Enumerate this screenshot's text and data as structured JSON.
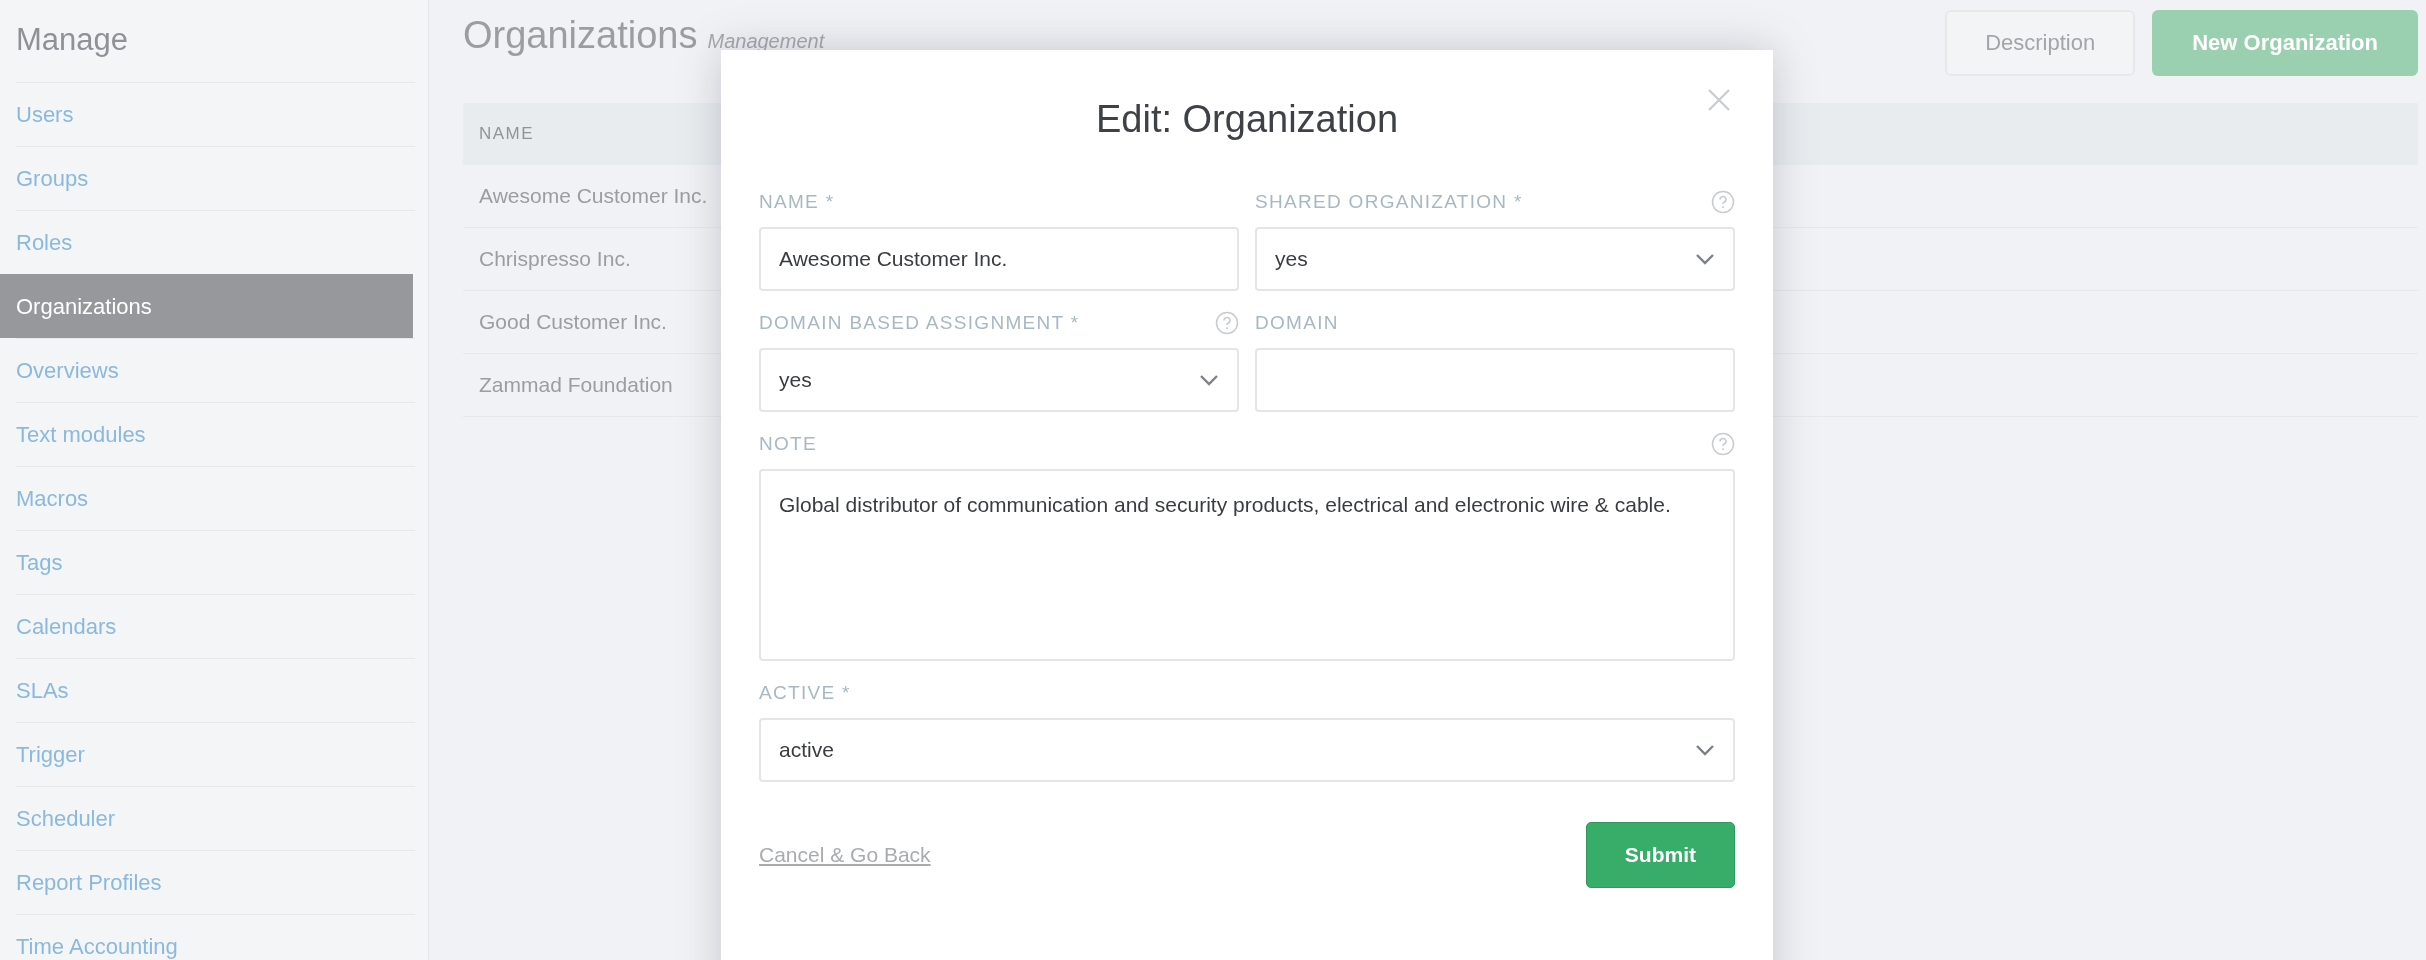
{
  "sidebar": {
    "title": "Manage",
    "items": [
      {
        "label": "Users",
        "selected": false
      },
      {
        "label": "Groups",
        "selected": false
      },
      {
        "label": "Roles",
        "selected": false
      },
      {
        "label": "Organizations",
        "selected": true
      },
      {
        "label": "Overviews",
        "selected": false
      },
      {
        "label": "Text modules",
        "selected": false
      },
      {
        "label": "Macros",
        "selected": false
      },
      {
        "label": "Tags",
        "selected": false
      },
      {
        "label": "Calendars",
        "selected": false
      },
      {
        "label": "SLAs",
        "selected": false
      },
      {
        "label": "Trigger",
        "selected": false
      },
      {
        "label": "Scheduler",
        "selected": false
      },
      {
        "label": "Report Profiles",
        "selected": false
      },
      {
        "label": "Time Accounting",
        "selected": false
      }
    ]
  },
  "page": {
    "title": "Organizations",
    "subtitle": "Management",
    "buttons": [
      {
        "label": "Description",
        "kind": "secondary"
      },
      {
        "label": "New Organization",
        "kind": "primary"
      }
    ]
  },
  "table": {
    "columns": [
      "NAME"
    ],
    "rows": [
      "Awesome Customer Inc.",
      "Chrispresso Inc.",
      "Good Customer Inc.",
      "Zammad Foundation"
    ]
  },
  "dialog": {
    "title": "Edit: Organization",
    "rows": [
      [
        {
          "label": "NAME *",
          "kind": "text",
          "value": "Awesome Customer Inc.",
          "help": false
        },
        {
          "label": "SHARED ORGANIZATION *",
          "kind": "select",
          "value": "yes",
          "help": true
        }
      ],
      [
        {
          "label": "DOMAIN BASED ASSIGNMENT *",
          "kind": "select",
          "value": "yes",
          "help": true
        },
        {
          "label": "DOMAIN",
          "kind": "text",
          "help": false
        }
      ],
      [
        {
          "label": "NOTE",
          "kind": "textarea",
          "value": "Global distributor of communication and security products, electrical and electronic wire & cable.",
          "help": true
        }
      ],
      [
        {
          "label": "ACTIVE *",
          "kind": "select",
          "value": "active",
          "help": false
        }
      ]
    ],
    "cancel": "Cancel & Go Back",
    "submit": "Submit"
  }
}
